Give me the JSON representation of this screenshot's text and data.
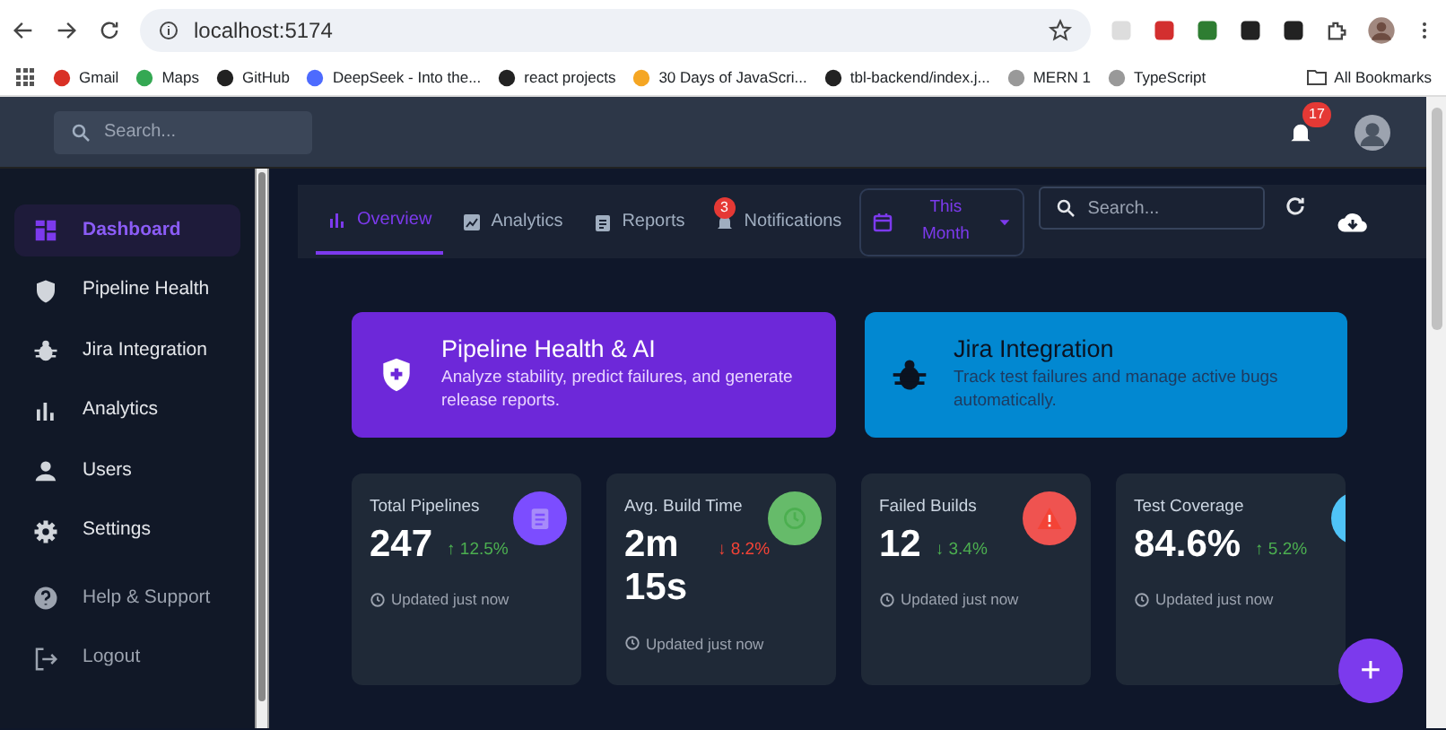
{
  "browser": {
    "url": "localhost:5174",
    "bookmarks": [
      "Gmail",
      "Maps",
      "GitHub",
      "DeepSeek - Into the...",
      "react projects",
      "30 Days of JavaScri...",
      "tbl-backend/index.j...",
      "MERN 1",
      "TypeScript"
    ],
    "all_bookmarks": "All Bookmarks"
  },
  "header": {
    "search_placeholder": "Search...",
    "notification_count": "17"
  },
  "sidebar": {
    "items": [
      {
        "label": "Dashboard",
        "selected": true
      },
      {
        "label": "Pipeline Health",
        "selected": false
      },
      {
        "label": "Jira Integration",
        "selected": false
      },
      {
        "label": "Analytics",
        "selected": false
      },
      {
        "label": "Users",
        "selected": false
      },
      {
        "label": "Settings",
        "selected": false
      }
    ],
    "footer_items": [
      "Help & Support",
      "Logout"
    ]
  },
  "tabs": [
    {
      "label": "Overview",
      "selected": true
    },
    {
      "label": "Analytics",
      "selected": false
    },
    {
      "label": "Reports",
      "selected": false
    },
    {
      "label": "Notifications",
      "selected": false,
      "badge": "3"
    }
  ],
  "period": "This Month",
  "toolbar_search_placeholder": "Search...",
  "feature_cards": [
    {
      "title": "Pipeline Health & AI",
      "text": "Analyze stability, predict failures, and generate release reports.",
      "color": "#6d28d9"
    },
    {
      "title": "Jira Integration",
      "text": "Track test failures and manage active bugs automatically.",
      "color": "#0288d1"
    }
  ],
  "stats": [
    {
      "label": "Total Pipelines",
      "value": "247",
      "change": "↑ 12.5%",
      "positive": true,
      "color": "#7c4dff",
      "updated": "Updated just now"
    },
    {
      "label": "Avg. Build Time",
      "value": "2m 15s",
      "change": "↓ 8.2%",
      "positive": false,
      "color": "#66bb6a",
      "updated": "Updated just now"
    },
    {
      "label": "Failed Builds",
      "value": "12",
      "change": "↓ 3.4%",
      "positive": true,
      "color": "#ef5350",
      "updated": "Updated just now"
    },
    {
      "label": "Test Coverage",
      "value": "84.6%",
      "change": "↑ 5.2%",
      "positive": true,
      "color": "#4fc3f7",
      "updated": "Updated just now"
    }
  ],
  "fab": "+"
}
